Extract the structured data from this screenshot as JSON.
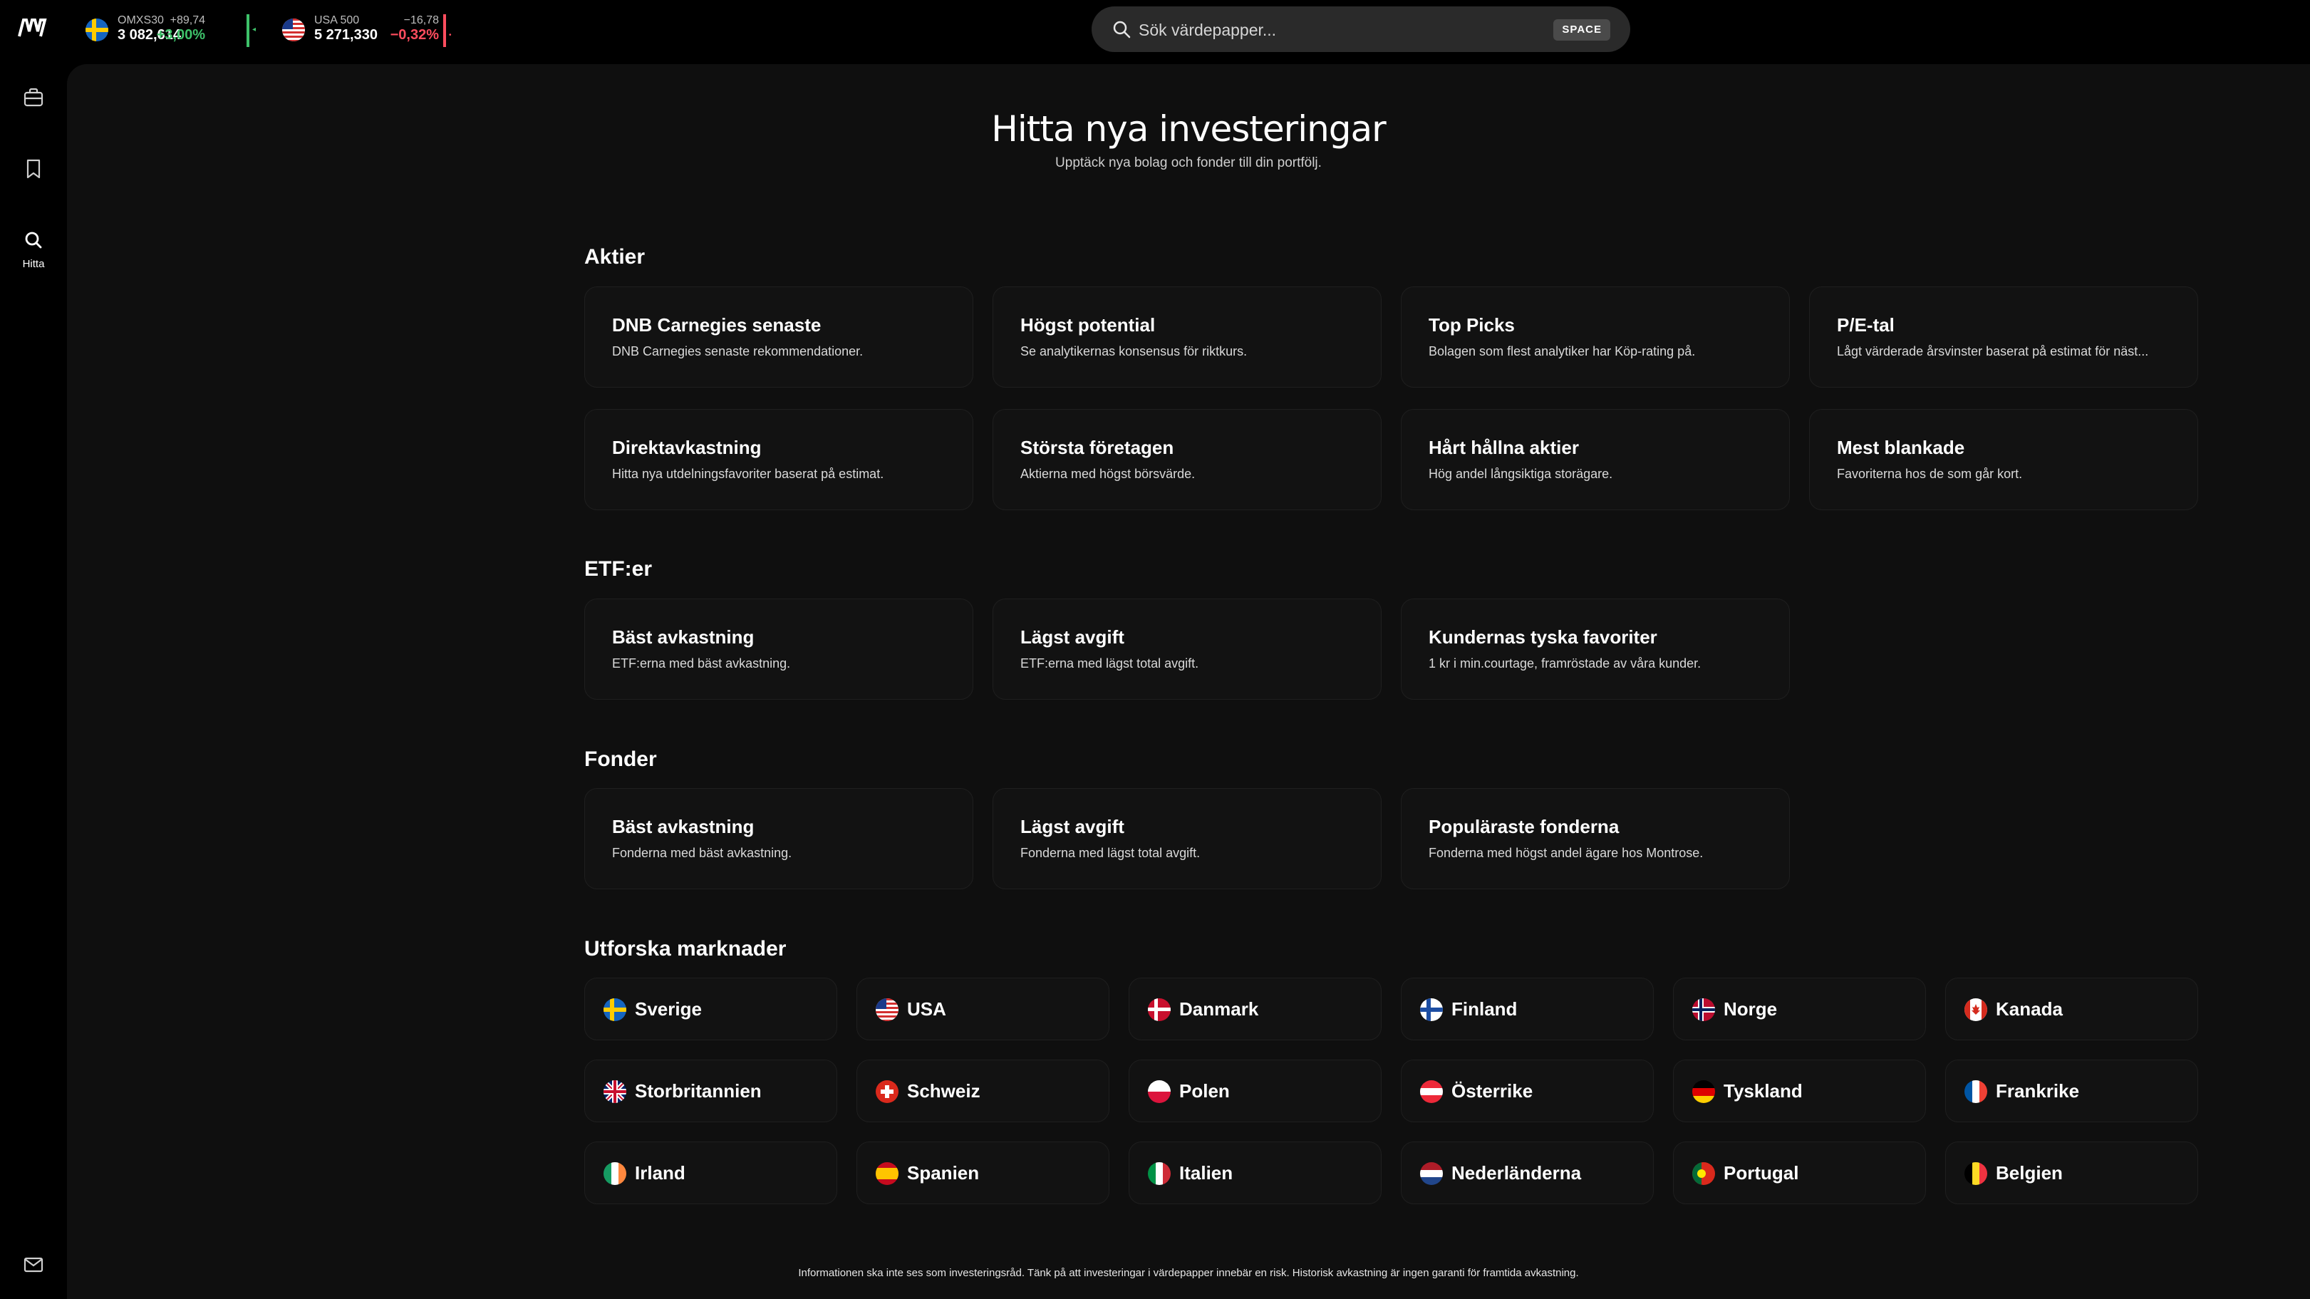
{
  "app": {
    "logo_text": "MV"
  },
  "tickers": [
    {
      "name": "OMXS30",
      "value": "3 082,614",
      "change_abs": "+89,74",
      "change_pct": "+3,00%",
      "direction": "up",
      "flag": "sweden-flag-icon"
    },
    {
      "name": "USA 500",
      "value": "5 271,330",
      "change_abs": "−16,78",
      "change_pct": "−0,32%",
      "direction": "down",
      "flag": "usa-flag-icon"
    }
  ],
  "search": {
    "placeholder": "Sök värdepapper...",
    "shortcut": "SPACE"
  },
  "sidebar": {
    "items": [
      {
        "name": "portfolio",
        "icon": "briefcase-icon",
        "label": ""
      },
      {
        "name": "watchlist",
        "icon": "bookmark-icon",
        "label": ""
      },
      {
        "name": "discover",
        "icon": "search-icon",
        "label": "Hitta",
        "active": true
      }
    ],
    "bottom_icon": "mail-icon"
  },
  "header": {
    "title": "Hitta nya investeringar",
    "subtitle": "Upptäck nya bolag och fonder till din portfölj."
  },
  "sections": {
    "stocks": {
      "title": "Aktier",
      "cards": [
        {
          "title": "DNB Carnegies senaste",
          "desc": "DNB Carnegies senaste rekommendationer."
        },
        {
          "title": "Högst potential",
          "desc": "Se analytikernas konsensus för riktkurs."
        },
        {
          "title": "Top Picks",
          "desc": "Bolagen som flest analytiker har Köp-rating på."
        },
        {
          "title": "P/E-tal",
          "desc": "Lågt värderade årsvinster baserat på estimat för näst..."
        },
        {
          "title": "Direktavkastning",
          "desc": "Hitta nya utdelningsfavoriter baserat på estimat."
        },
        {
          "title": "Största företagen",
          "desc": "Aktierna med högst börsvärde."
        },
        {
          "title": "Hårt hållna aktier",
          "desc": "Hög andel långsiktiga storägare."
        },
        {
          "title": "Mest blankade",
          "desc": "Favoriterna hos de som går kort."
        }
      ]
    },
    "etfs": {
      "title": "ETF:er",
      "cards": [
        {
          "title": "Bäst avkastning",
          "desc": "ETF:erna med bäst avkastning."
        },
        {
          "title": "Lägst avgift",
          "desc": "ETF:erna med lägst total avgift."
        },
        {
          "title": "Kundernas tyska favoriter",
          "desc": "1 kr i min.courtage, framröstade av våra kunder."
        }
      ]
    },
    "funds": {
      "title": "Fonder",
      "cards": [
        {
          "title": "Bäst avkastning",
          "desc": "Fonderna med bäst avkastning."
        },
        {
          "title": "Lägst avgift",
          "desc": "Fonderna med lägst total avgift."
        },
        {
          "title": "Populäraste fonderna",
          "desc": "Fonderna med högst andel ägare hos Montrose."
        }
      ]
    },
    "markets": {
      "title": "Utforska marknader",
      "items": [
        {
          "name": "Sverige",
          "flag": "sweden-flag-icon"
        },
        {
          "name": "USA",
          "flag": "usa-flag-icon"
        },
        {
          "name": "Danmark",
          "flag": "denmark-flag-icon"
        },
        {
          "name": "Finland",
          "flag": "finland-flag-icon"
        },
        {
          "name": "Norge",
          "flag": "norway-flag-icon"
        },
        {
          "name": "Kanada",
          "flag": "canada-flag-icon"
        },
        {
          "name": "Storbritannien",
          "flag": "uk-flag-icon"
        },
        {
          "name": "Schweiz",
          "flag": "switzerland-flag-icon"
        },
        {
          "name": "Polen",
          "flag": "poland-flag-icon"
        },
        {
          "name": "Österrike",
          "flag": "austria-flag-icon"
        },
        {
          "name": "Tyskland",
          "flag": "germany-flag-icon"
        },
        {
          "name": "Frankrike",
          "flag": "france-flag-icon"
        },
        {
          "name": "Irland",
          "flag": "ireland-flag-icon"
        },
        {
          "name": "Spanien",
          "flag": "spain-flag-icon"
        },
        {
          "name": "Italien",
          "flag": "italy-flag-icon"
        },
        {
          "name": "Nederländerna",
          "flag": "netherlands-flag-icon"
        },
        {
          "name": "Portugal",
          "flag": "portugal-flag-icon"
        },
        {
          "name": "Belgien",
          "flag": "belgium-flag-icon"
        }
      ]
    }
  },
  "footer": {
    "disclaimer": "Informationen ska inte ses som investeringsråd. Tänk på att investeringar i värdepapper innebär en risk. Historisk avkastning är ingen garanti för framtida avkastning."
  },
  "colors": {
    "up": "#3ec26a",
    "down": "#ff4d5e",
    "background": "#000000",
    "panel": "#0f0f0f",
    "card": "#121212"
  }
}
